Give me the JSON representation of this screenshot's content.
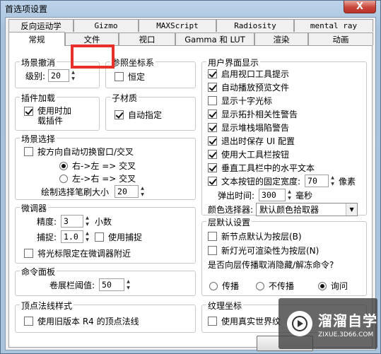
{
  "window": {
    "title": "首选项设置",
    "close": "X"
  },
  "tabs_back": [
    "反向运动学",
    "Gizmo",
    "MAXScript",
    "Radiosity",
    "mental ray"
  ],
  "tabs_front": [
    "常规",
    "文件",
    "视口",
    "Gamma 和 LUT",
    "渲染",
    "动画"
  ],
  "scene_undo": {
    "title": "场景撤消",
    "level_label": "级别:",
    "level_value": "20"
  },
  "ref_coord": {
    "title": "参照坐标系",
    "constant_label": "恒定"
  },
  "plugin_load": {
    "title": "插件加载",
    "load_on_use_label": "使用时加\n载插件"
  },
  "sub_material": {
    "title": "子材质",
    "auto_assign_label": "自动指定"
  },
  "scene_selection": {
    "title": "场景选择",
    "auto_window_label": "按方向自动切换窗口/交叉",
    "rtl_label": "右->左 => 交叉",
    "ltr_label": "左->右 => 交叉",
    "brush_size_label": "绘制选择笔刷大小",
    "brush_size_value": "20"
  },
  "spinners": {
    "title": "微调器",
    "precision_label": "精度:",
    "precision_value": "3",
    "precision_unit": "小数",
    "snap_label": "捕捉:",
    "snap_value": "1.0",
    "use_snap_label": "使用捕捉",
    "wrap_cursor_label": "将光标限定在微调器附近"
  },
  "command_panel": {
    "title": "命令面板",
    "rollup_label": "卷展栏阈值:",
    "rollup_value": "50"
  },
  "vertex_normal": {
    "title": "顶点法线样式",
    "legacy_label": "使用旧版本 R4 的顶点法线"
  },
  "ui_display": {
    "title": "用户界面显示",
    "items": [
      {
        "label": "启用视口工具提示",
        "checked": true
      },
      {
        "label": "自动播放预览文件",
        "checked": true
      },
      {
        "label": "显示十字光标",
        "checked": false
      },
      {
        "label": "显示拓扑相关性警告",
        "checked": true
      },
      {
        "label": "显示堆栈塌陷警告",
        "checked": true
      },
      {
        "label": "退出时保存 UI 配置",
        "checked": true
      },
      {
        "label": "使用大工具栏按钮",
        "checked": true
      },
      {
        "label": "垂直工具栏中的水平文本",
        "checked": true
      }
    ],
    "fixed_width_label": "文本按钮的固定宽度:",
    "fixed_width_value": "70",
    "fixed_width_unit": "像素",
    "flyout_label": "弹出时间:",
    "flyout_value": "300",
    "flyout_unit": "毫秒",
    "color_picker_label": "颜色选择器:",
    "color_picker_value": "默认颜色拾取器"
  },
  "layer_defaults": {
    "title": "层默认设置",
    "new_nodes_label": "新节点默认为按层(B)",
    "new_lights_label": "新灯光可渲染性为按层(N)",
    "propagate_question": "是否向层传播取消隐藏/解冻命令?",
    "opt_propagate": "传播",
    "opt_no_propagate": "不传播",
    "opt_ask": "询问"
  },
  "texture_coords": {
    "title": "纹理坐标",
    "real_world_label": "使用真实世界纹"
  },
  "watermark": {
    "brand": "溜溜自学",
    "url": "ZIXUE.3D66.COM"
  },
  "colors": {
    "highlight": "#e8302a",
    "close_red": "#c8463a"
  }
}
